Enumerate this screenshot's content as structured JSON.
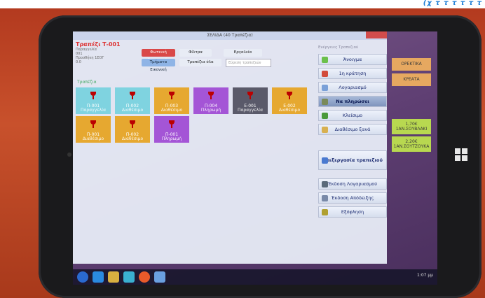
{
  "banner": {
    "text": "(χ τ τ τ τ τ τ"
  },
  "app": {
    "window_title": "ΣΕΛΙΔΑ (40 Τραπέζια)",
    "table_title": "Τραπέζι Τ-001",
    "info_lines": [
      "Παραγγελία",
      "001",
      "Προσθήκη 1ΕΟΓ",
      "0.0"
    ],
    "toolbar": {
      "new_order": "Φωτεινή Λειτουργία",
      "filters": "Φίλτρα",
      "tools": "Εργαλεία",
      "layout": "Τμήματα Εικονική",
      "all_tables": "Τραπέζια όλα",
      "search_placeholder": "Εύρεση τραπεζιών"
    },
    "tables_label": "Τραπέζια",
    "tables": [
      {
        "name": "Π-001",
        "status": "Παραγγελία",
        "color": "#7fd3e0"
      },
      {
        "name": "Π-002",
        "status": "Διαθέσιμο",
        "color": "#7fd3e0"
      },
      {
        "name": "Π-003",
        "status": "Διαθέσιμο",
        "color": "#e6a830"
      },
      {
        "name": "Π-004",
        "status": "Πληρωμή",
        "color": "#a455d6"
      },
      {
        "name": "Ε-001",
        "status": "Παραγγελία",
        "color": "#5a5a6a"
      },
      {
        "name": "Ε-002",
        "status": "Διαθέσιμο",
        "color": "#e6a830"
      },
      {
        "name": "Π-001",
        "status": "Διαθέσιμο",
        "color": "#e6a830"
      },
      {
        "name": "Π-002",
        "status": "Διαθέσιμο",
        "color": "#e6a830"
      },
      {
        "name": "Π-001",
        "status": "Πληρωμή",
        "color": "#a455d6"
      }
    ],
    "panel": {
      "header": "Ενέργειες Τραπεζιού",
      "buttons": [
        {
          "label": "Άνοιγμα",
          "icon_color": "#6bc04a",
          "style": ""
        },
        {
          "label": "1η κράτηση",
          "icon_color": "#d24a3a",
          "style": ""
        },
        {
          "label": "Λογαριασμό",
          "icon_color": "#7aa0d8",
          "style": ""
        },
        {
          "label": "Να πληρώσει",
          "icon_color": "#7a8a5a",
          "style": "dark"
        },
        {
          "label": "Κλείσιμο",
          "icon_color": "#4a9a3a",
          "style": ""
        },
        {
          "label": "Διαθέσιμο ξανά",
          "icon_color": "#d8b050",
          "style": ""
        },
        {
          "label": "Επεξεργασία τραπεζιού",
          "icon_color": "#4a7ad0",
          "style": "tall"
        },
        {
          "label": "Έκδοση Λογαριασμού",
          "icon_color": "#5a6a7a",
          "style": ""
        },
        {
          "label": "Έκδοση Απόδειξης",
          "icon_color": "#7a8aa8",
          "style": ""
        },
        {
          "label": "Εξόφληση",
          "icon_color": "#b0a030",
          "style": ""
        }
      ]
    },
    "side_tiles": [
      {
        "label": "ΟΡΕΚΤΙΚΑ",
        "color": "#e6a860"
      },
      {
        "label": "ΚΡΕΑΤΑ",
        "color": "#e6a860"
      },
      {
        "label": "1,70€ 1ΑΝ.ΣΟΥΒΛΑΚΙ",
        "color": "#b8d850"
      },
      {
        "label": "2,20€ 1ΑΝ.ΣΟΥΤΖΟΥΚΑ",
        "color": "#b8d850"
      }
    ]
  },
  "taskbar": {
    "tray_time": "1:07 μμ"
  }
}
